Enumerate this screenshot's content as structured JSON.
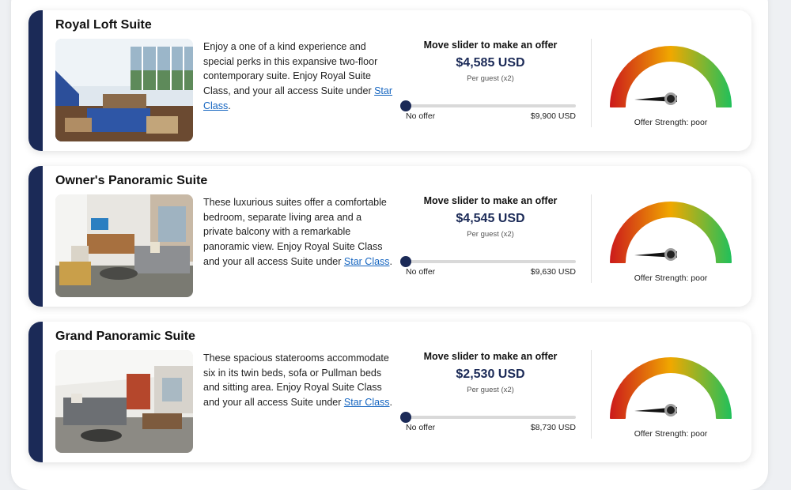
{
  "offer_prompt": "Move slider to make an offer",
  "per_guest": "Per guest (x2)",
  "min_label": "No offer",
  "strength_label": "Offer Strength: poor",
  "link_text": "Star Class",
  "colors": {
    "accent": "#1b2a57",
    "link": "#1565c0",
    "gauge_low": "#cc1b1b",
    "gauge_mid": "#f0a800",
    "gauge_high": "#22c05a"
  },
  "suites": [
    {
      "title": "Royal Loft Suite",
      "description": "Enjoy a one of a kind experience and special perks in this expansive two-floor contemporary suite. Enjoy Royal Suite Class, and your all access Suite under ",
      "price": "$4,585 USD",
      "max_label": "$9,900 USD",
      "slider_fraction": 0,
      "photo_icon": "loft-suite-photo"
    },
    {
      "title": "Owner's Panoramic Suite",
      "description": "These luxurious suites offer a comfortable bedroom, separate living area and a private balcony with a remarkable panoramic view. Enjoy Royal Suite Class and your all access Suite under ",
      "price": "$4,545 USD",
      "max_label": "$9,630 USD",
      "slider_fraction": 0,
      "photo_icon": "panoramic-suite-photo"
    },
    {
      "title": "Grand Panoramic Suite",
      "description": "These spacious staterooms accommodate six in its twin beds, sofa or Pullman beds and sitting area. Enjoy Royal Suite Class and your all access Suite under ",
      "price": "$2,530 USD",
      "max_label": "$8,730 USD",
      "slider_fraction": 0,
      "photo_icon": "grand-suite-photo"
    }
  ]
}
